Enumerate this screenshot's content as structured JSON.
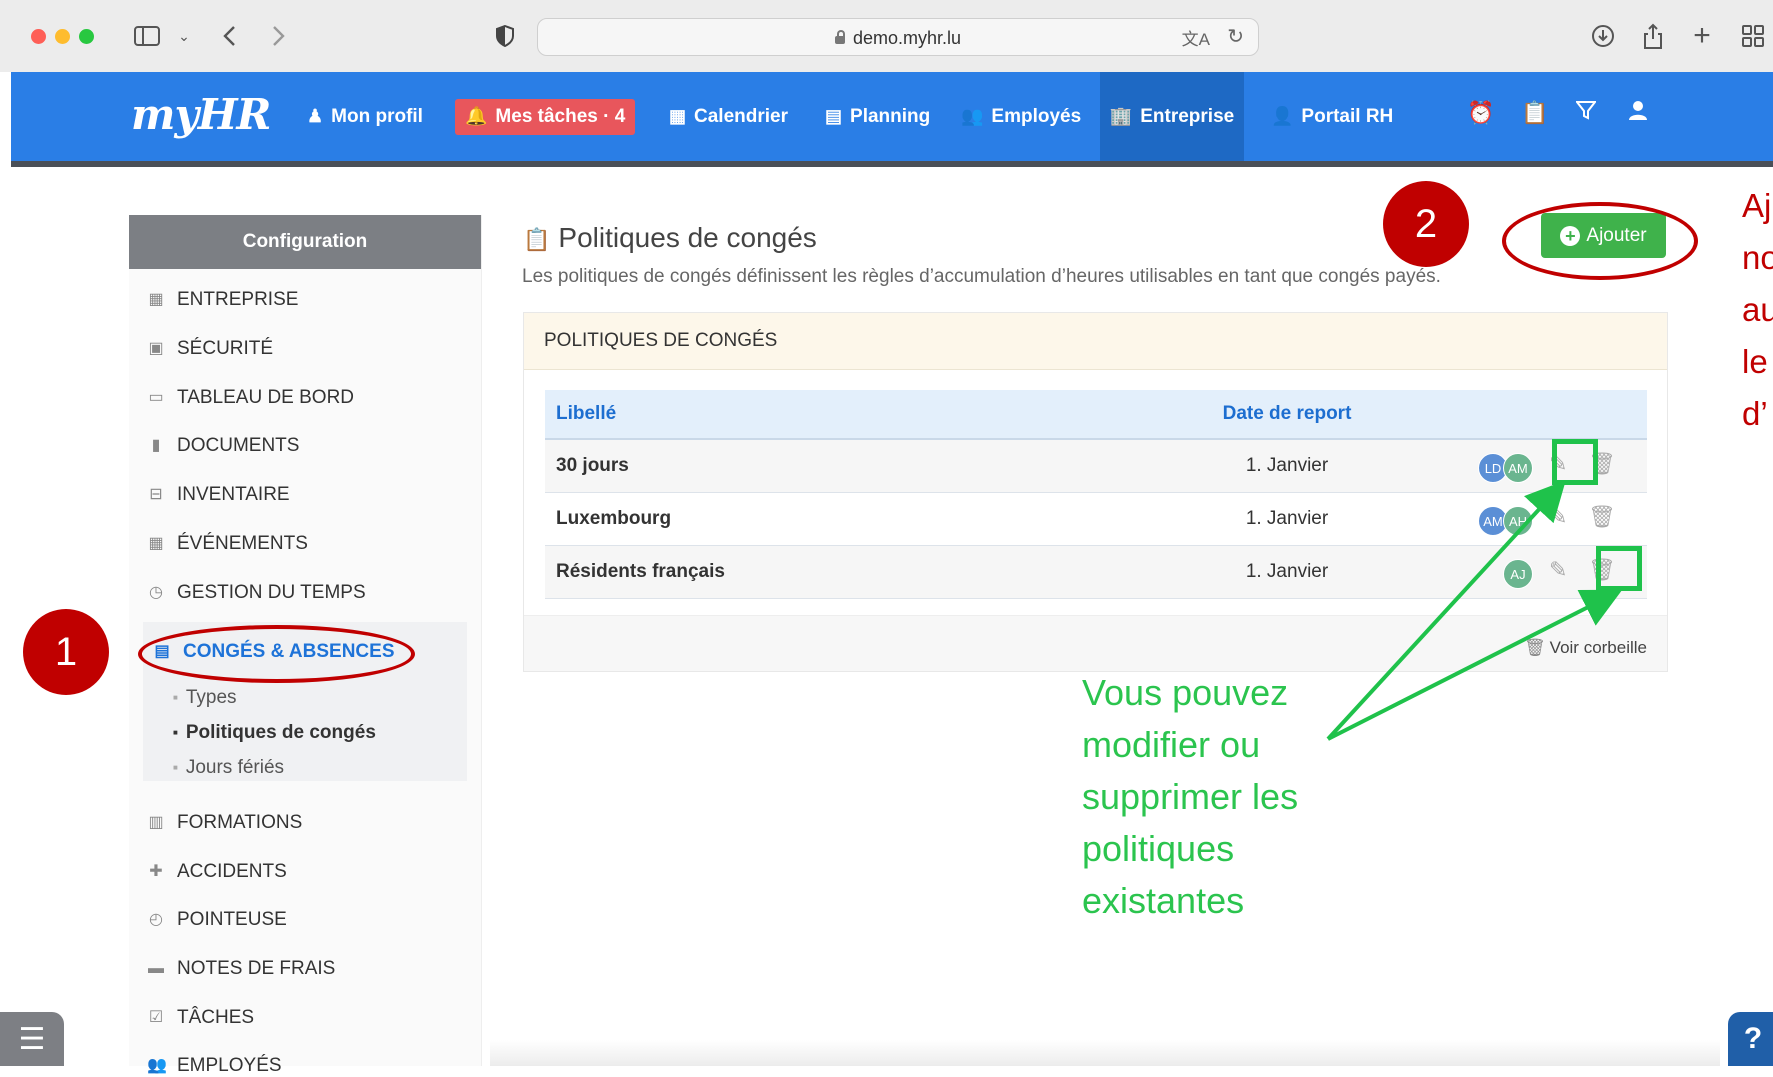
{
  "browser": {
    "url": "demo.myhr.lu",
    "traffic_colors": [
      "#fe5f57",
      "#febc2e",
      "#28c840"
    ]
  },
  "app": {
    "logo": "myHR",
    "nav": [
      {
        "label": "Mon profil",
        "icon": "user-tie-icon"
      },
      {
        "label": "Mes tâches · 4",
        "icon": "bell-icon"
      },
      {
        "label": "Calendrier",
        "icon": "calendar-icon"
      },
      {
        "label": "Planning",
        "icon": "planning-icon"
      },
      {
        "label": "Employés",
        "icon": "users-icon"
      },
      {
        "label": "Entreprise",
        "icon": "building-icon",
        "active": true
      },
      {
        "label": "Portail RH",
        "icon": "portal-icon"
      }
    ],
    "nav_icons": [
      "alarm-icon",
      "clipboard-icon",
      "filter-icon",
      "user-icon"
    ],
    "accent": "#2a7ee6"
  },
  "sidebar": {
    "header": "Configuration",
    "items": [
      "ENTREPRISE",
      "SÉCURITÉ",
      "TABLEAU DE BORD",
      "DOCUMENTS",
      "INVENTAIRE",
      "ÉVÉNEMENTS",
      "GESTION DU TEMPS",
      "CONGÉS & ABSENCES",
      "FORMATIONS",
      "ACCIDENTS",
      "POINTEUSE",
      "NOTES DE FRAIS",
      "TÂCHES",
      "EMPLOYÉS"
    ],
    "subitems": [
      "Types",
      "Politiques de congés",
      "Jours fériés"
    ]
  },
  "main": {
    "title": "Politiques de congés",
    "subtitle": "Les politiques de congés définissent les règles d’accumulation d’heures utilisables en tant que congés payés.",
    "add_label": "Ajouter",
    "panel_title": "POLITIQUES DE CONGÉS",
    "columns": [
      "Libellé",
      "Date de report"
    ],
    "rows": [
      {
        "label": "30 jours",
        "date": "1. Janvier",
        "avatars": [
          "LD",
          "AM"
        ]
      },
      {
        "label": "Luxembourg",
        "date": "1. Janvier",
        "avatars": [
          "AM",
          "AH"
        ]
      },
      {
        "label": "Résidents français",
        "date": "1. Janvier",
        "avatars": [
          "AJ"
        ]
      }
    ],
    "trash_link": "Voir corbeille"
  },
  "annotations": {
    "step1": "1",
    "step2": "2",
    "note": "Vous pouvez modifier ou supprimer les politiques existantes",
    "right_note_lines": [
      "Aj",
      "no",
      "au",
      "le",
      "d’"
    ],
    "red": "#c00000",
    "green": "#1fc24b"
  }
}
